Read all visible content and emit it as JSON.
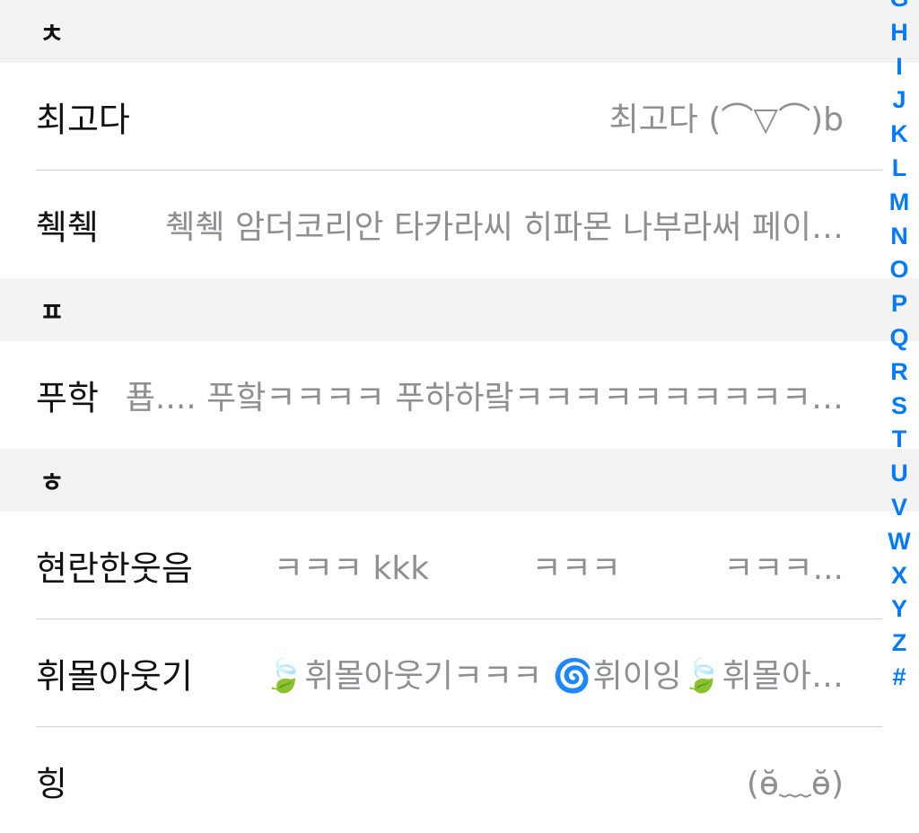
{
  "colors": {
    "accent": "#007aff",
    "section_bg": "#f3f3f3",
    "detail_text": "#8e8e93",
    "separator": "#cfcfd3"
  },
  "sections": [
    {
      "header": "ㅊ",
      "rows": [
        {
          "title": "최고다",
          "detail": "최고다 (⌒▽⌒)b"
        },
        {
          "title": "췍췍",
          "detail": "췍췍 암더코리안 타카라씨 히파몬 나부라써 페이…"
        }
      ]
    },
    {
      "header": "ㅍ",
      "rows": [
        {
          "title": "푸학",
          "detail": "푭.... 푸핰ㅋㅋㅋㅋ 푸하하랔ㅋㅋㅋㅋㅋㅋㅋㅋㅋㅋ…"
        }
      ]
    },
    {
      "header": "ㅎ",
      "rows": [
        {
          "title": "현란한웃음",
          "detail": "ㅋㅋㅋ kkk          ㅋㅋㅋ          ㅋㅋㅋ..."
        },
        {
          "title": "휘몰아웃기",
          "detail": "🍃휘몰아웃기ㅋㅋㅋ 🌀휘이잉🍃휘몰아…"
        },
        {
          "title": "힝",
          "detail": "(ɵ̆﹏ɵ̆)"
        }
      ]
    }
  ],
  "index_letters": [
    "G",
    "H",
    "I",
    "J",
    "K",
    "L",
    "M",
    "N",
    "O",
    "P",
    "Q",
    "R",
    "S",
    "T",
    "U",
    "V",
    "W",
    "X",
    "Y",
    "Z",
    "#"
  ]
}
